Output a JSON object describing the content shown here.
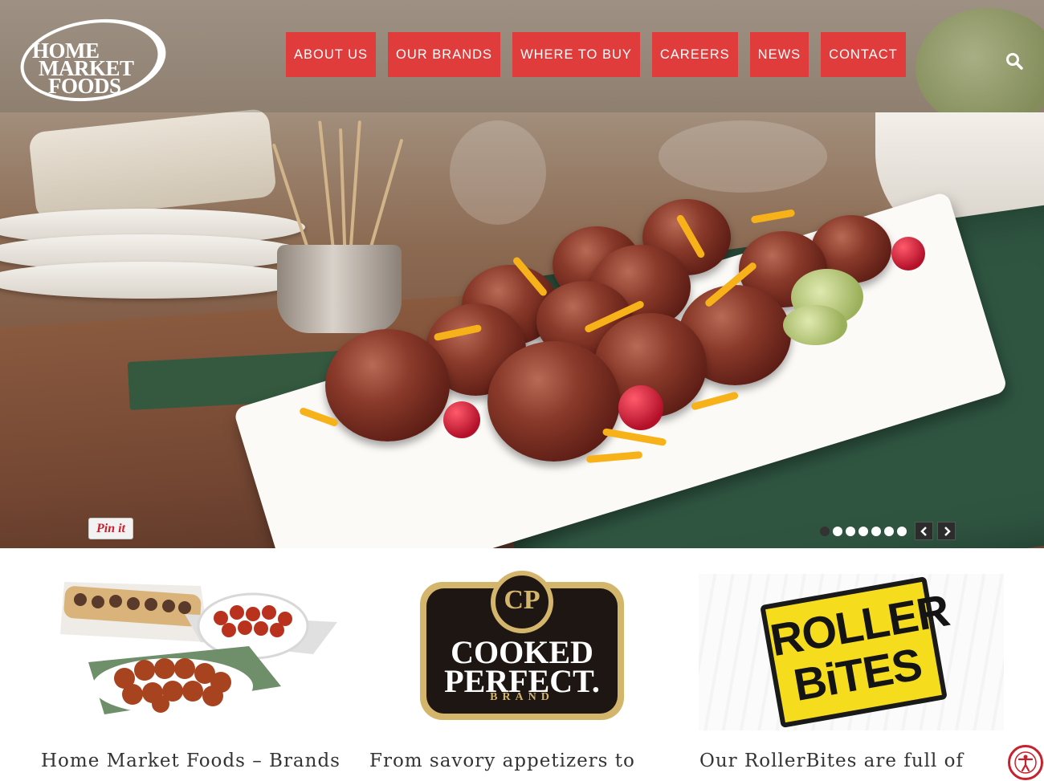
{
  "logo": {
    "line1": "HOME",
    "line2": "MARKET",
    "line3": "FOODS"
  },
  "nav": {
    "items": [
      {
        "label": "ABOUT US"
      },
      {
        "label": "OUR BRANDS"
      },
      {
        "label": "WHERE TO BUY"
      },
      {
        "label": "CAREERS"
      },
      {
        "label": "NEWS"
      },
      {
        "label": "CONTACT"
      }
    ],
    "search_icon": "search-icon"
  },
  "slider": {
    "pin_label": "Pin it",
    "slide_count": 7,
    "active_slide": 1,
    "prev_icon": "chevron-left-icon",
    "next_icon": "chevron-right-icon"
  },
  "brands": [
    {
      "caption": "Home Market Foods – Brands"
    },
    {
      "caption": "From savory appetizers to",
      "logo_mark": "CP",
      "logo_line1": "COOKED",
      "logo_line2": "PERFECT.",
      "logo_line3": "BRAND"
    },
    {
      "caption": "Our RollerBites are full of",
      "logo_line1": "ROLLER",
      "logo_line2": "BiTES"
    }
  ],
  "colors": {
    "nav_bg": "#e03c3c",
    "accent_gold": "#d3b56b",
    "rollerbites_yellow": "#f5dd1d"
  },
  "accessibility_icon": "accessibility-icon"
}
